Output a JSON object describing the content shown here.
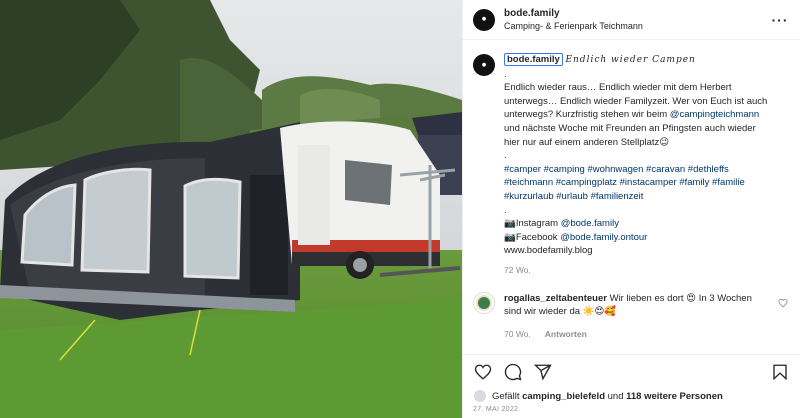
{
  "post": {
    "username": "bode.family",
    "location": "Camping- & Ferienpark Teichmann",
    "more_icon": "more-horizontal-icon"
  },
  "caption": {
    "username": "bode.family",
    "title_script": "Endlich wieder Campen",
    "dot": ".",
    "lines": [
      "Endlich wieder raus… Endlich wieder mit dem Herbert",
      "unterwegs… Endlich wieder Familyzeit. Wer von Euch ist auch",
      "unterwegs? Kurzfristig stehen wir beim",
      "@campingteichmann",
      "und nächste Woche mit Freunden an Pfingsten auch wieder",
      "hier nur auf einem anderen Stellplatz😉"
    ],
    "hashtags": [
      "#camper #camping #wohnwagen #caravan #dethleffs",
      "#teichmann #campingplatz #instacamper #family #familie",
      "#kurzurlaub #urlaub #familienzeit"
    ],
    "instagram_label": "📷Instagram",
    "instagram_handle": "@bode.family",
    "facebook_label": "📷Facebook",
    "facebook_handle": "@bode.family.ontour",
    "website": "www.bodefamily.blog",
    "age": "72 Wo."
  },
  "comment": {
    "username": "rogallas_zeltabenteuer",
    "text_line1": "Wir lieben es dort 😍 In 3 Wochen",
    "text_line2": "sind wir wieder da ☀️😍🥰",
    "age": "70 Wo.",
    "reply_label": "Antworten"
  },
  "likes": {
    "prefix": "Gefällt",
    "first_user": "camping_bielefeld",
    "connector": "und",
    "others": "118 weitere Personen"
  },
  "date": "27. MAI 2022"
}
